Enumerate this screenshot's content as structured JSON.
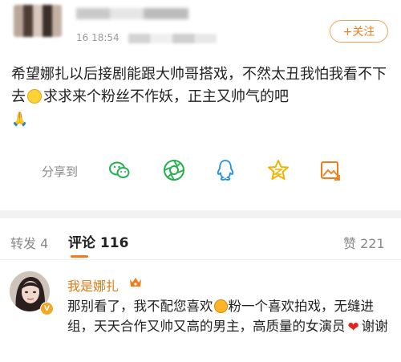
{
  "post": {
    "time": "16 18:54",
    "follow_label": "+关注",
    "text_segments": [
      "希望娜扎以后接剧能跟大帅哥搭戏，不然太丑我怕我看不下去",
      "求求来个粉丝不作妖，正主又帅气的吧"
    ],
    "share": {
      "label": "分享到",
      "targets": [
        "wechat-icon",
        "moments-icon",
        "qq-icon",
        "qzone-icon",
        "weibo-gallery-icon"
      ]
    }
  },
  "tabs": {
    "repost": "转发 4",
    "comments": "评论 116",
    "likes": "赞 221"
  },
  "comment": {
    "author": "我是娜扎",
    "text_segments": [
      "那别看了，我不配您喜欢",
      "粉一个喜欢拍戏，无缝进组，天天合作又帅又高的男主，高质量的女演员",
      "谢谢"
    ]
  },
  "colors": {
    "accent": "#f07d1a",
    "muted": "#888888",
    "separator": "#f2f2f2",
    "heart": "#e0261f"
  }
}
